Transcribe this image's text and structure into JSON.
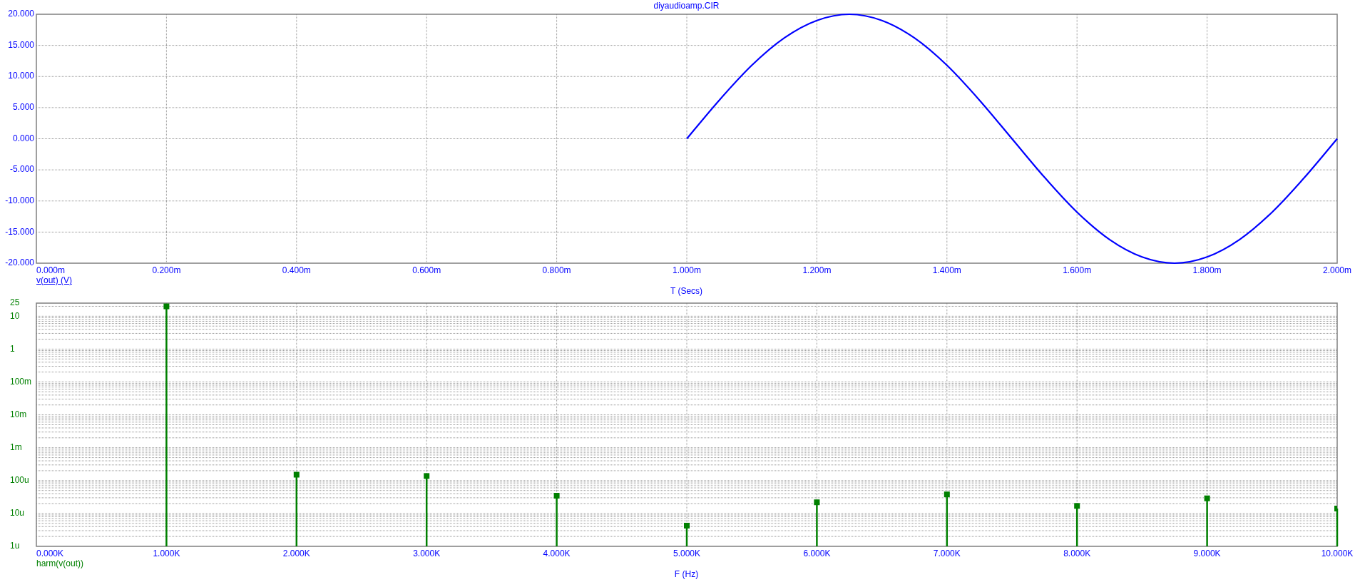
{
  "title": "diyaudioamp.CIR",
  "transient": {
    "chart_data": {
      "type": "line",
      "xlabel": "T (Secs)",
      "x": [
        1,
        1.05,
        1.1,
        1.15,
        1.2,
        1.25,
        1.3,
        1.35,
        1.4,
        1.45,
        1.5,
        1.55,
        1.6,
        1.65,
        1.7,
        1.75,
        1.8,
        1.85,
        1.9,
        1.95,
        2
      ],
      "series": [
        {
          "name": "v(out) (V)",
          "color": "#0000ff",
          "values": [
            0,
            6.2,
            11.8,
            16.2,
            19,
            20,
            19,
            16.2,
            11.8,
            6.2,
            0,
            -6.2,
            -11.8,
            -16.2,
            -19,
            -20,
            -19,
            -16.2,
            -11.8,
            -6.2,
            0
          ]
        }
      ],
      "xlim": [
        0,
        2
      ],
      "ylim": [
        -20,
        20
      ],
      "grid": true,
      "xticks": [
        {
          "value": 0,
          "label": "0.000m"
        },
        {
          "value": 0.2,
          "label": "0.200m"
        },
        {
          "value": 0.4,
          "label": "0.400m"
        },
        {
          "value": 0.6,
          "label": "0.600m"
        },
        {
          "value": 0.8,
          "label": "0.800m"
        },
        {
          "value": 1,
          "label": "1.000m"
        },
        {
          "value": 1.2,
          "label": "1.200m"
        },
        {
          "value": 1.4,
          "label": "1.400m"
        },
        {
          "value": 1.6,
          "label": "1.600m"
        },
        {
          "value": 1.8,
          "label": "1.800m"
        },
        {
          "value": 2,
          "label": "2.000m"
        }
      ],
      "yticks": [
        {
          "value": 20,
          "label": "20.000"
        },
        {
          "value": 15,
          "label": "15.000"
        },
        {
          "value": 10,
          "label": "10.000"
        },
        {
          "value": 5,
          "label": "5.000"
        },
        {
          "value": 0,
          "label": "0.000"
        },
        {
          "value": -5,
          "label": "-5.000"
        },
        {
          "value": -10,
          "label": "-10.000"
        },
        {
          "value": -15,
          "label": "-15.000"
        },
        {
          "value": -20,
          "label": "-20.000"
        }
      ]
    }
  },
  "spectrum": {
    "y_axis_labels": [
      "25",
      "10",
      "1",
      "100m",
      "10m",
      "1m",
      "100u",
      "10u",
      "1u"
    ],
    "x_axis_labels": [
      "0.000K",
      "1.000K",
      "2.000K",
      "3.000K",
      "4.000K",
      "5.000K",
      "6.000K",
      "7.000K",
      "8.000K",
      "9.000K",
      "10.000K"
    ],
    "trace_label": "harm(v(out))",
    "axis_title": "F (Hz)"
  }
}
